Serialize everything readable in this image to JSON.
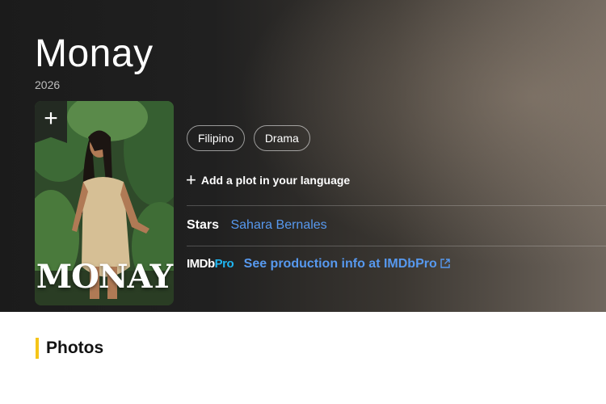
{
  "title": "Monay",
  "year": "2026",
  "poster": {
    "add_symbol": "+",
    "title_text": "MONAY",
    "add_icon": "plus-icon"
  },
  "genres": [
    "Filipino",
    "Drama"
  ],
  "plot": {
    "icon": "plus-icon",
    "label": "Add a plot in your language"
  },
  "stars": {
    "label": "Stars",
    "names": [
      "Sahara Bernales"
    ]
  },
  "imdbpro": {
    "logo_imdb": "IMDb",
    "logo_pro": "Pro",
    "link_label": "See production info at IMDbPro",
    "icon": "external-link-icon"
  },
  "photos": {
    "heading": "Photos"
  },
  "colors": {
    "accent": "#f5c518",
    "link": "#5799ef",
    "pro": "#1fb6f1",
    "hero_dark": "#1b1b1b"
  }
}
